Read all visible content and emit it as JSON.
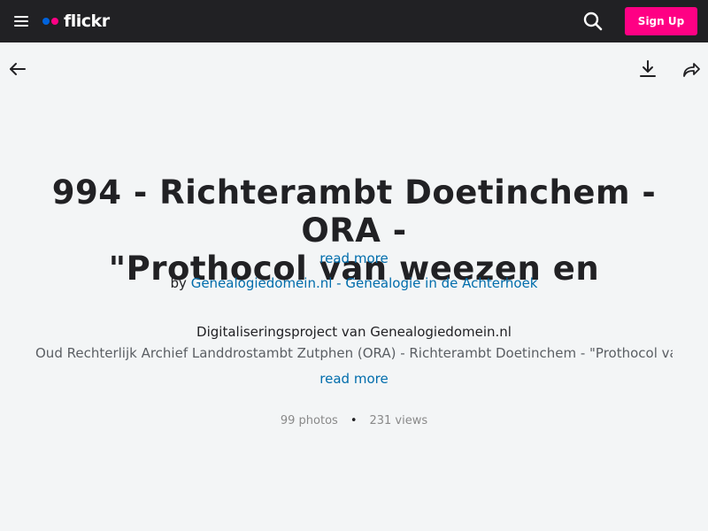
{
  "header": {
    "logo_text": "flickr",
    "signup_label": "Sign Up",
    "colors": {
      "bar": "#212124",
      "logo_blue": "#0063dc",
      "logo_pink": "#ff0084",
      "signup": "#ff0084"
    }
  },
  "toolbar": {
    "icons": [
      "back-arrow-icon",
      "download-icon",
      "share-icon"
    ]
  },
  "album": {
    "title_line1": "994 - Richterambt Doetinchem - ORA -",
    "title_line2": "\"Prothocol van weezen en",
    "read_more": "read more",
    "by_prefix": "by",
    "owner": "Genealogiedomein.nl - Genealogie in de Achterhoek",
    "description_line1": "Digitaliseringsproject van Genealogiedomein.nl",
    "description_line2": "Oud Rechterlijk Archief Landdrostambt Zutphen (ORA) - Richterambt Doetinchem - \"Prothocol van",
    "read_more_description": "read more",
    "photos": "99 photos",
    "separator": "•",
    "views": "231 views",
    "link_color": "#006dac"
  }
}
